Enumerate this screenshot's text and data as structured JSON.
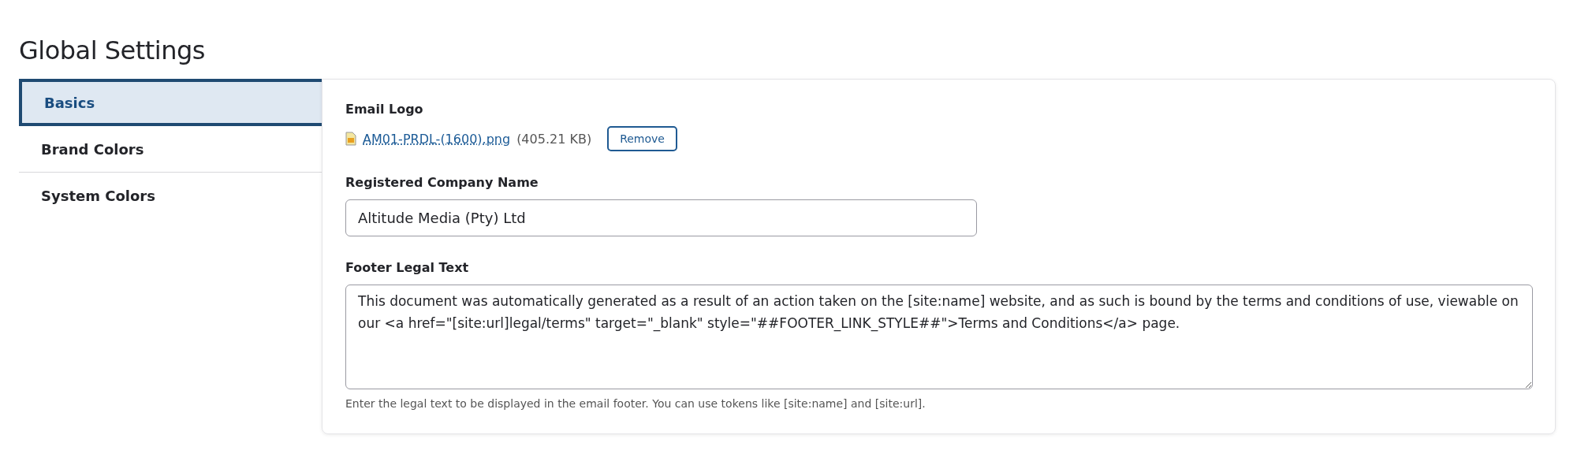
{
  "page_title": "Global Settings",
  "tabs": [
    {
      "label": "Basics",
      "selected": true
    },
    {
      "label": "Brand Colors",
      "selected": false
    },
    {
      "label": "System Colors",
      "selected": false
    }
  ],
  "email_logo": {
    "label": "Email Logo",
    "file_name": "AM01-PRDL-(1600).png",
    "file_size": "(405.21 KB)",
    "remove_button": "Remove"
  },
  "company_name": {
    "label": "Registered Company Name",
    "value": "Altitude Media (Pty) Ltd"
  },
  "footer_legal_text": {
    "label": "Footer Legal Text",
    "value": "This document was automatically generated as a result of an action taken on the [site:name] website, and as such is bound by the terms and conditions of use, viewable on our <a href=\"[site:url]legal/terms\" target=\"_blank\" style=\"##FOOTER_LINK_STYLE##\">Terms and Conditions</a> page.",
    "help": "Enter the legal text to be displayed in the email footer. You can use tokens like [site:name] and [site:url]."
  }
}
